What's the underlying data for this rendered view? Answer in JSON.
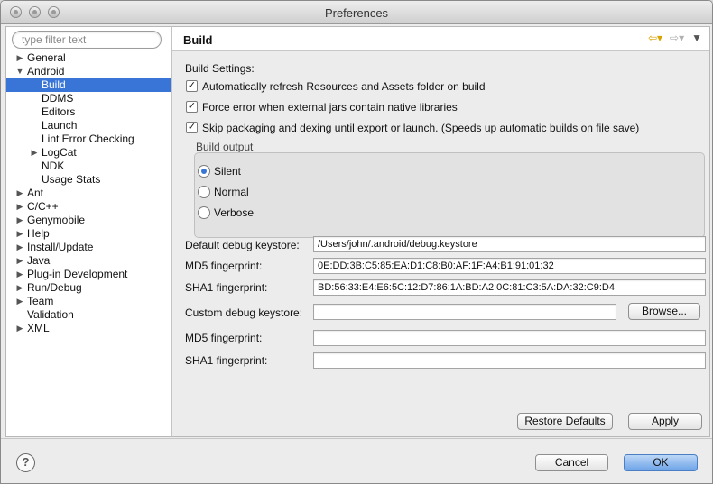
{
  "window": {
    "title": "Preferences"
  },
  "filter": {
    "placeholder": "type filter text"
  },
  "tree": [
    {
      "label": "General",
      "arrow": "▶"
    },
    {
      "label": "Android",
      "arrow": "▼"
    },
    {
      "label": "Build",
      "arrow": ""
    },
    {
      "label": "DDMS",
      "arrow": ""
    },
    {
      "label": "Editors",
      "arrow": ""
    },
    {
      "label": "Launch",
      "arrow": ""
    },
    {
      "label": "Lint Error Checking",
      "arrow": ""
    },
    {
      "label": "LogCat",
      "arrow": "▶"
    },
    {
      "label": "NDK",
      "arrow": ""
    },
    {
      "label": "Usage Stats",
      "arrow": ""
    },
    {
      "label": "Ant",
      "arrow": "▶"
    },
    {
      "label": "C/C++",
      "arrow": "▶"
    },
    {
      "label": "Genymobile",
      "arrow": "▶"
    },
    {
      "label": "Help",
      "arrow": "▶"
    },
    {
      "label": "Install/Update",
      "arrow": "▶"
    },
    {
      "label": "Java",
      "arrow": "▶"
    },
    {
      "label": "Plug-in Development",
      "arrow": "▶"
    },
    {
      "label": "Run/Debug",
      "arrow": "▶"
    },
    {
      "label": "Team",
      "arrow": "▶"
    },
    {
      "label": "Validation",
      "arrow": ""
    },
    {
      "label": "XML",
      "arrow": "▶"
    }
  ],
  "page": {
    "title": "Build",
    "build_settings_label": "Build Settings:",
    "options": [
      {
        "label": "Automatically refresh Resources and Assets folder on build",
        "checked": true
      },
      {
        "label": "Force error when external jars contain native libraries",
        "checked": true
      },
      {
        "label": "Skip packaging and dexing until export or launch. (Speeds up automatic builds on file save)",
        "checked": true
      }
    ],
    "build_output": {
      "label": "Build output",
      "choices": [
        "Silent",
        "Normal",
        "Verbose"
      ],
      "selected": "Silent"
    },
    "default_keystore_label": "Default debug keystore:",
    "default_keystore_value": "/Users/john/.android/debug.keystore",
    "md5_label": "MD5 fingerprint:",
    "md5_value": "0E:DD:3B:C5:85:EA:D1:C8:B0:AF:1F:A4:B1:91:01:32",
    "sha1_label": "SHA1 fingerprint:",
    "sha1_value": "BD:56:33:E4:E6:5C:12:D7:86:1A:BD:A2:0C:81:C3:5A:DA:32:C9:D4",
    "custom_keystore_label": "Custom debug keystore:",
    "custom_keystore_value": "",
    "browse_label": "Browse...",
    "custom_md5_label": "MD5 fingerprint:",
    "custom_md5_value": "",
    "custom_sha1_label": "SHA1 fingerprint:",
    "custom_sha1_value": "",
    "restore_defaults_label": "Restore Defaults",
    "apply_label": "Apply"
  },
  "footer": {
    "help_glyph": "?",
    "cancel_label": "Cancel",
    "ok_label": "OK"
  },
  "icons": {
    "back": "back-arrow-icon",
    "forward": "forward-arrow-icon",
    "menu": "view-menu-icon"
  },
  "colors": {
    "selection": "#3875d7",
    "default_button": "#6da3e8"
  }
}
